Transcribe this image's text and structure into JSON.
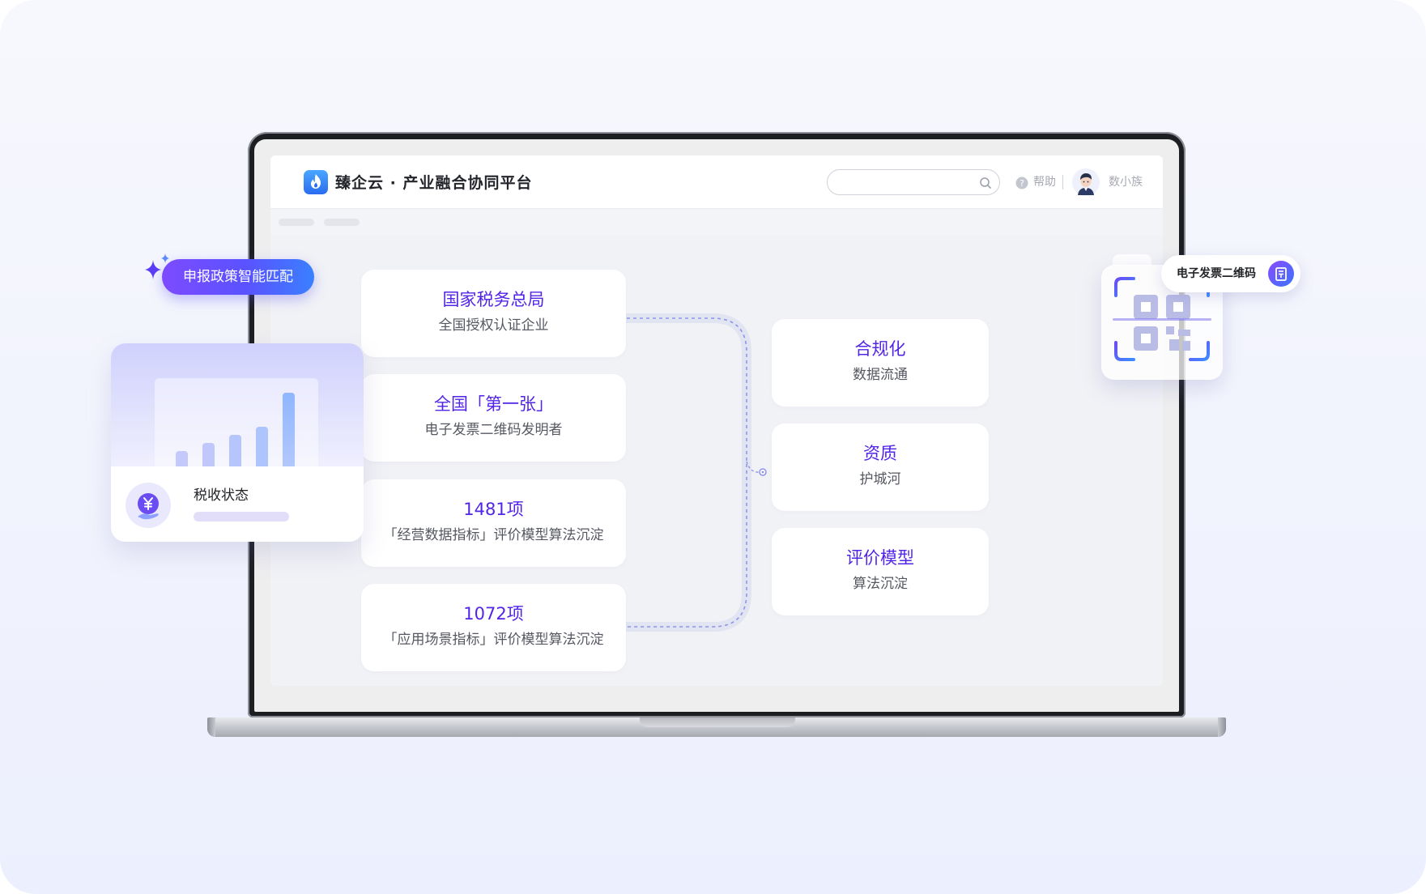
{
  "app": {
    "title": "臻企云 · 产业融合协同平台",
    "search": {
      "placeholder": ""
    },
    "help_label": "帮助",
    "user_name": "数小族"
  },
  "left_cards": [
    {
      "title": "国家税务总局",
      "subtitle": "全国授权认证企业"
    },
    {
      "title": "全国「第一张」",
      "subtitle": "电子发票二维码发明者"
    },
    {
      "title": "1481项",
      "subtitle": "「经营数据指标」评价模型算法沉淀"
    },
    {
      "title": "1072项",
      "subtitle": "「应用场景指标」评价模型算法沉淀"
    }
  ],
  "right_cards": [
    {
      "title": "合规化",
      "subtitle": "数据流通"
    },
    {
      "title": "资质",
      "subtitle": "护城河"
    },
    {
      "title": "评价模型",
      "subtitle": "算法沉淀"
    }
  ],
  "floating": {
    "policy_pill": "申报政策智能匹配",
    "tax_card_label": "税收状态",
    "qr_pill_label": "电子发票二维码"
  },
  "colors": {
    "accent_purple": "#5225e6",
    "pill_gradient_start": "#7d4bff",
    "pill_gradient_end": "#3a80ff",
    "logo_blue": "#2a6cf0"
  },
  "icons": {
    "logo": "flame-logo-icon",
    "search": "search-icon",
    "help": "help-circle-icon",
    "avatar": "user-avatar-icon",
    "sparkle": "sparkle-icon",
    "tax": "yuan-coin-icon",
    "qr": "qr-code-icon",
    "invoice": "invoice-icon"
  }
}
